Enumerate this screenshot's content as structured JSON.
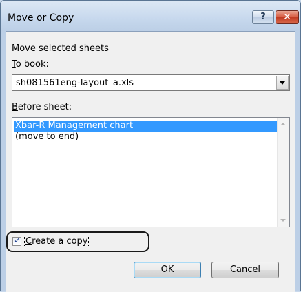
{
  "window": {
    "title": "Move or Copy",
    "help_label": "?",
    "close_label": "✕"
  },
  "dialog": {
    "heading": "Move selected sheets",
    "to_book_label_accel": "T",
    "to_book_label_rest": "o book:",
    "to_book_value": "sh081561eng-layout_a.xls",
    "before_sheet_accel": "B",
    "before_sheet_rest": "efore sheet:",
    "sheets": [
      {
        "label": "Xbar-R Management chart",
        "selected": true
      },
      {
        "label": "(move to end)",
        "selected": false
      }
    ],
    "create_copy_accel": "C",
    "create_copy_rest": "reate a copy",
    "create_copy_checked": true,
    "ok_label": "OK",
    "cancel_label": "Cancel"
  }
}
